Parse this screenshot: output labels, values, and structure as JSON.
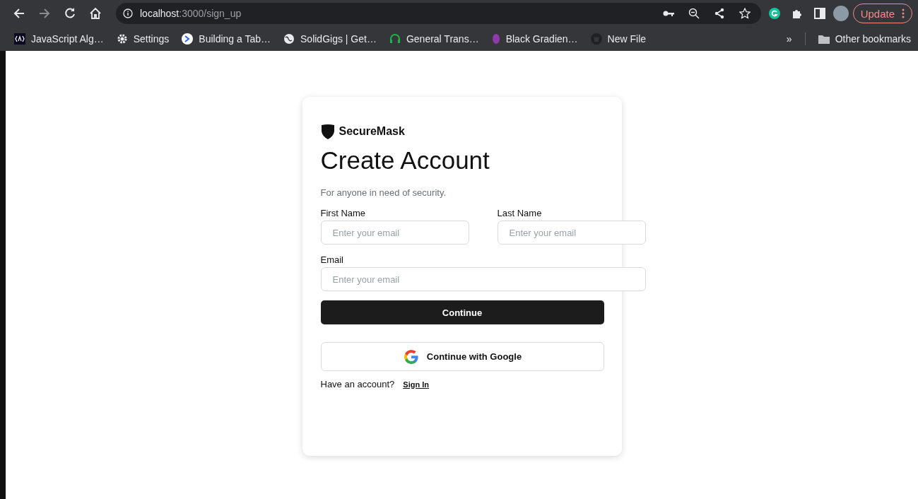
{
  "browser": {
    "url_host": "localhost",
    "url_path": ":3000/sign_up",
    "update_label": "Update",
    "bookmarks": [
      {
        "label": "JavaScript Alg…"
      },
      {
        "label": "Settings"
      },
      {
        "label": "Building a Tab…"
      },
      {
        "label": "SolidGigs | Get…"
      },
      {
        "label": "General Trans…"
      },
      {
        "label": "Black Gradien…"
      },
      {
        "label": "New File"
      }
    ],
    "overflow": "»",
    "other_bookmarks": "Other bookmarks"
  },
  "card": {
    "brand": "SecureMask",
    "title": "Create Account",
    "subtitle": "For anyone in need of security.",
    "fields": [
      {
        "label": "First Name",
        "placeholder": "Enter your email"
      },
      {
        "label": "Last Name",
        "placeholder": "Enter your email"
      },
      {
        "label": "Email",
        "placeholder": "Enter your email"
      }
    ],
    "continue_button": "Continue",
    "google_button": "Continue with Google",
    "account_prompt": "Have an account?",
    "sign_in_link": "Sign In"
  }
}
